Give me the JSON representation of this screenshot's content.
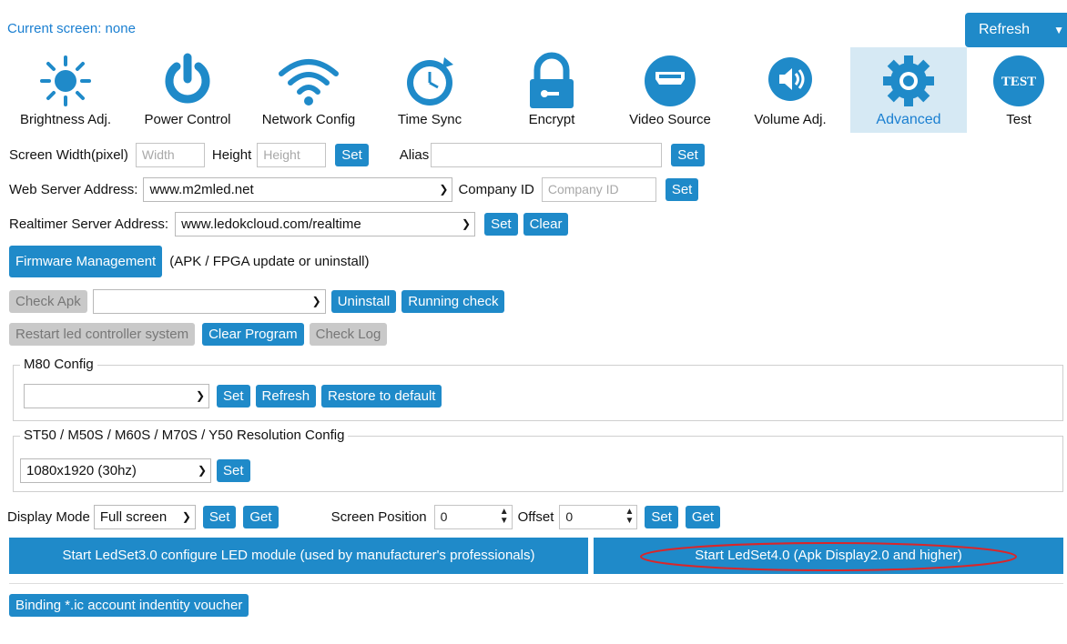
{
  "status": {
    "current_screen": "Current screen: none"
  },
  "top_refresh": {
    "label": "Refresh"
  },
  "tiles": [
    {
      "label": "Brightness Adj."
    },
    {
      "label": "Power Control"
    },
    {
      "label": "Network Config"
    },
    {
      "label": "Time Sync"
    },
    {
      "label": "Encrypt"
    },
    {
      "label": "Video Source"
    },
    {
      "label": "Volume Adj."
    },
    {
      "label": "Advanced"
    },
    {
      "label": "Test"
    }
  ],
  "test_icon_text": "TEST",
  "row1": {
    "width_label": "Screen Width(pixel)",
    "width_placeholder": "Width",
    "height_label": "Height",
    "height_placeholder": "Height",
    "set": "Set",
    "alias_label": "Alias",
    "alias_value": "",
    "alias_set": "Set"
  },
  "row2": {
    "label": "Web Server Address:",
    "value": "www.m2mled.net",
    "company_label": "Company ID",
    "company_placeholder": "Company ID",
    "set": "Set"
  },
  "row3": {
    "label": "Realtimer Server Address:",
    "value": "www.ledokcloud.com/realtime",
    "set": "Set",
    "clear": "Clear"
  },
  "row4": {
    "button": "Firmware Management",
    "note": "(APK / FPGA update or uninstall)"
  },
  "row5": {
    "check_apk": "Check Apk",
    "select_value": "",
    "uninstall": "Uninstall",
    "running_check": "Running check"
  },
  "row6": {
    "restart": "Restart led controller system",
    "clear_program": "Clear Program",
    "check_log": "Check Log"
  },
  "m80": {
    "legend": "M80 Config",
    "select_value": "",
    "set": "Set",
    "refresh": "Refresh",
    "restore": "Restore to default"
  },
  "res": {
    "legend": "ST50 / M50S / M60S / M70S / Y50 Resolution Config",
    "select_value": "1080x1920  (30hz)",
    "set": "Set"
  },
  "display": {
    "label": "Display Mode",
    "mode": "Full screen",
    "set": "Set",
    "get": "Get",
    "pos_label": "Screen Position",
    "pos_value": "0",
    "offset_label": "Offset",
    "offset_value": "0",
    "set2": "Set",
    "get2": "Get"
  },
  "ledset": {
    "v3": "Start LedSet3.0 configure LED module (used by manufacturer's professionals)",
    "v4": "Start LedSet4.0 (Apk Display2.0 and higher)"
  },
  "binding": {
    "label": "Binding *.ic account indentity voucher"
  },
  "colors": {
    "accent": "#1f8ac9",
    "active_tab": "#d6e9f4",
    "link": "#1a7fd1",
    "disabled": "#c9c9c9",
    "highlight_ellipse": "#d9262a"
  }
}
